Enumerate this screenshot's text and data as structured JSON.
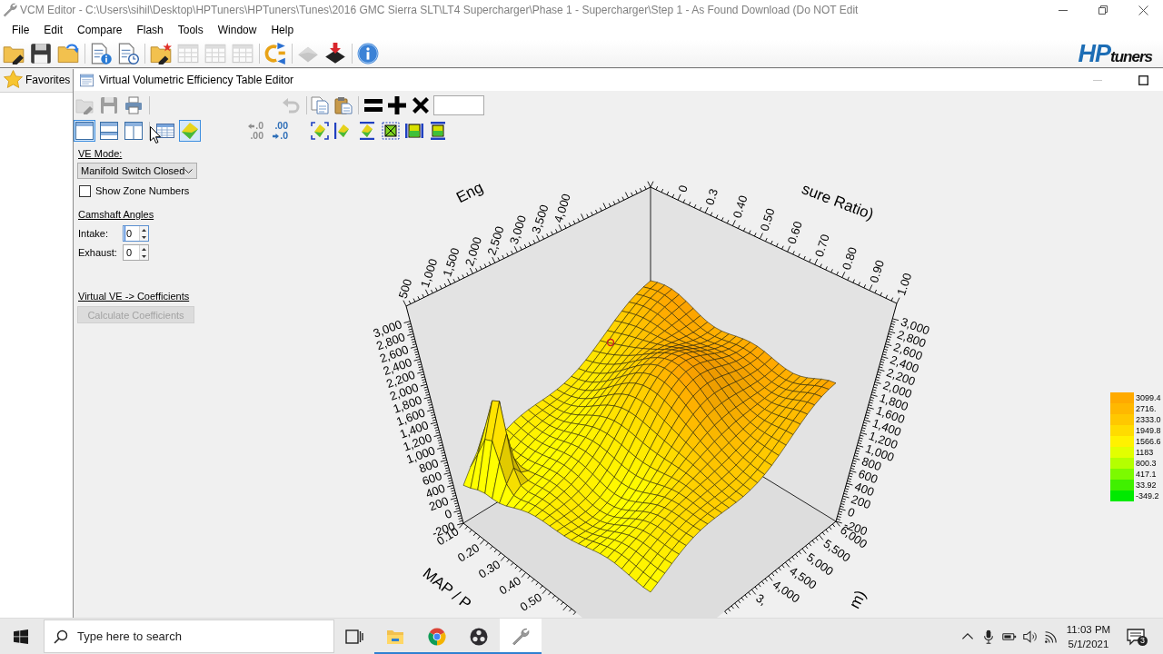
{
  "window": {
    "title": "VCM Editor - C:\\Users\\sihil\\Desktop\\HPTuners\\HPTuners\\Tunes\\2016 GMC Sierra SLT\\LT4 Supercharger\\Phase 1 - Supercharger\\Step 1 - As Found Download (Do NOT Edit"
  },
  "menu": [
    "File",
    "Edit",
    "Compare",
    "Flash",
    "Tools",
    "Window",
    "Help"
  ],
  "toolbar": [
    {
      "kind": "open",
      "disabled": false
    },
    {
      "kind": "save",
      "disabled": false
    },
    {
      "kind": "open-back",
      "disabled": false
    },
    {
      "kind": "separator"
    },
    {
      "kind": "doc-info",
      "disabled": false
    },
    {
      "kind": "doc-clock",
      "disabled": false
    },
    {
      "kind": "separator"
    },
    {
      "kind": "folder-chip",
      "disabled": false
    },
    {
      "kind": "table",
      "disabled": true
    },
    {
      "kind": "table",
      "disabled": true
    },
    {
      "kind": "table",
      "disabled": true
    },
    {
      "kind": "separator"
    },
    {
      "kind": "convert",
      "disabled": false
    },
    {
      "kind": "separator"
    },
    {
      "kind": "chip",
      "disabled": true
    },
    {
      "kind": "chip-write",
      "disabled": false
    },
    {
      "kind": "separator"
    },
    {
      "kind": "info",
      "disabled": false
    }
  ],
  "logo": {
    "mark": "HP",
    "word": "tuners"
  },
  "favorites": {
    "label": "Favorites"
  },
  "editor": {
    "title": "Virtual Volumetric Efficiency Table Editor",
    "toolbar_rows": [
      [
        [
          {
            "kind": "open",
            "disabled": true
          },
          {
            "kind": "save",
            "disabled": true
          },
          {
            "kind": "print",
            "disabled": false
          },
          {
            "kind": "separator"
          }
        ],
        [
          {
            "kind": "undo",
            "disabled": true
          },
          {
            "kind": "separator"
          }
        ],
        [
          {
            "kind": "copy",
            "disabled": false
          },
          {
            "kind": "paste",
            "disabled": false
          },
          {
            "kind": "separator"
          },
          {
            "kind": "equals",
            "disabled": false
          },
          {
            "kind": "plus",
            "disabled": false
          },
          {
            "kind": "multiply",
            "disabled": false
          },
          {
            "kind": "input"
          }
        ]
      ],
      [
        [
          {
            "kind": "pane-single",
            "selected": true
          },
          {
            "kind": "pane-rows",
            "selected": false
          },
          {
            "kind": "pane-columns",
            "selected": false
          },
          {
            "kind": "separator"
          },
          {
            "kind": "table-view",
            "selected": false
          },
          {
            "kind": "surface-view",
            "selected": true
          }
        ],
        [
          {
            "kind": "decimals-less",
            "disabled": true,
            "lines": [
              ".0",
              ".00"
            ]
          },
          {
            "kind": "decimals-more",
            "disabled": false,
            "lines": [
              ".00",
              ".0"
            ]
          }
        ],
        [
          {
            "kind": "plot-fit"
          },
          {
            "kind": "plot-side"
          },
          {
            "kind": "plot-top"
          },
          {
            "kind": "plot-box"
          },
          {
            "kind": "plot-gradient-side"
          },
          {
            "kind": "plot-gradient-top"
          }
        ]
      ]
    ],
    "ve_mode": {
      "label": "VE Mode:",
      "value": "Manifold Switch Closed"
    },
    "zone_numbers": {
      "label": "Show Zone Numbers",
      "checked": false
    },
    "camshaft": {
      "heading": "Camshaft Angles",
      "fields": [
        {
          "label": "Intake:",
          "value": "0",
          "focused": true
        },
        {
          "label": "Exhaust:",
          "value": "0",
          "focused": false
        }
      ]
    },
    "coefficients": {
      "heading": "Virtual VE -> Coefficients",
      "button": {
        "label": "Calculate Coefficients",
        "disabled": true
      }
    },
    "plot": {
      "axes": [
        {
          "kind": "engine-back",
          "title": "Eng",
          "ticks": [
            "500",
            "1,000",
            "1,500",
            "2,000",
            "2,500",
            "3,000",
            "3,500",
            "4,000"
          ]
        },
        {
          "kind": "ratio-back",
          "title": "sure Ratio)",
          "ticks": [
            "0",
            "0.3",
            "0.40",
            "0.50",
            "0.60",
            "0.70",
            "0.80",
            "0.90",
            "1.00"
          ]
        },
        {
          "kind": "value-left",
          "ticks": [
            "3,000",
            "2,800",
            "2,600",
            "2,400",
            "2,200",
            "2,000",
            "1,800",
            "1,600",
            "1,400",
            "1,200",
            "1,000",
            "800",
            "600",
            "400",
            "200",
            "0",
            "-200"
          ]
        },
        {
          "kind": "value-right",
          "ticks": [
            "3,000",
            "2,800",
            "2,600",
            "2,400",
            "2,200",
            "2,000",
            "1,800",
            "1,600",
            "1,400",
            "1,200",
            "1,000",
            "800",
            "600",
            "400",
            "200",
            "0",
            "-200"
          ]
        },
        {
          "kind": "ratio-front",
          "title": "MAP / P",
          "ticks": [
            "0.10",
            "0.20",
            "0.30",
            "0.40",
            "0.50"
          ]
        },
        {
          "kind": "engine-front",
          "title": "m)",
          "ticks": [
            "6,000",
            "5,500",
            "5,000",
            "4,500",
            "4,000",
            "3,"
          ]
        }
      ],
      "legend": [
        {
          "label": "3099.4",
          "color": "#ffaa00"
        },
        {
          "label": "2716.",
          "color": "#ffb800"
        },
        {
          "label": "2333.0",
          "color": "#ffc800"
        },
        {
          "label": "1949.8",
          "color": "#ffdc00"
        },
        {
          "label": "1566.6",
          "color": "#fff200"
        },
        {
          "label": "1183",
          "color": "#e2ff00"
        },
        {
          "label": "800.3",
          "color": "#b4ff00"
        },
        {
          "label": "417.1",
          "color": "#7cfa00"
        },
        {
          "label": "33.92",
          "color": "#40f000"
        },
        {
          "label": "-349.2",
          "color": "#00ea00"
        }
      ]
    }
  },
  "taskbar": {
    "search": {
      "placeholder": "Type here to search"
    },
    "apps": [
      {
        "kind": "task-view",
        "running": false,
        "selected": false
      },
      {
        "kind": "folder",
        "running": true,
        "selected": false
      },
      {
        "kind": "tricolor",
        "running": true,
        "selected": false
      },
      {
        "kind": "dark-circle",
        "running": true,
        "selected": false
      },
      {
        "kind": "wrench",
        "running": true,
        "selected": true
      }
    ],
    "tray": [
      {
        "kind": "chevron"
      },
      {
        "kind": "mic"
      },
      {
        "kind": "battery"
      },
      {
        "kind": "volume"
      },
      {
        "kind": "wifi"
      }
    ],
    "time": "11:03 PM",
    "date": "5/1/2021",
    "notifications": "3"
  }
}
